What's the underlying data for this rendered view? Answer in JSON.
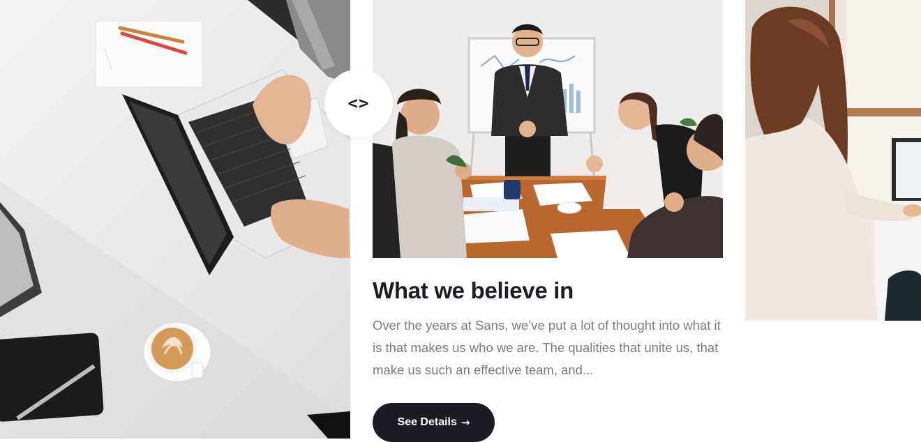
{
  "slider": {
    "nav_icon": "code-brackets-icon",
    "nav_glyph": "<>"
  },
  "card": {
    "title": "What we believe in",
    "description": "Over the years at Sans, we’ve put a lot of thought into what it is that makes us who we are. The qualities that unite us, that make us such an effective team, and...",
    "button_label": "See Details",
    "button_icon": "→"
  },
  "colors": {
    "button_bg": "#1c1c24",
    "title_text": "#1d1d24",
    "body_text": "#7a7a83"
  }
}
